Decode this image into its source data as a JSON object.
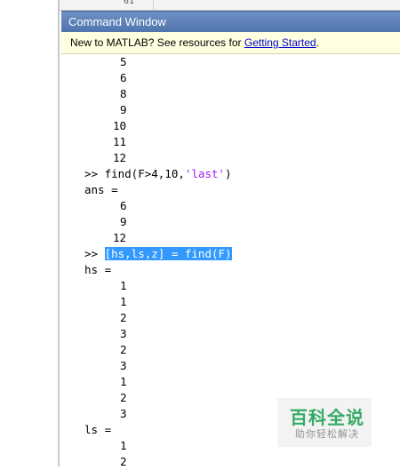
{
  "editor": {
    "line_number": "61"
  },
  "window": {
    "title": "Command Window"
  },
  "banner": {
    "prefix": "New to MATLAB? See resources for ",
    "link": "Getting Started",
    "suffix": "."
  },
  "console": {
    "top_numbers": [
      "5",
      "6",
      "8",
      "9",
      "10",
      "11",
      "12"
    ],
    "cmd1": {
      "prompt": ">> ",
      "code_a": "find(F>4,10,",
      "code_str": "'last'",
      "code_b": ")"
    },
    "ans_label": "ans =",
    "ans_numbers": [
      "6",
      "9",
      "12"
    ],
    "cmd2": {
      "prompt": ">> ",
      "code": "[hs,ls,z] = find(F)"
    },
    "hs_label": "hs =",
    "hs_numbers": [
      "1",
      "1",
      "2",
      "3",
      "2",
      "3",
      "1",
      "2",
      "3"
    ],
    "ls_label": "ls =",
    "ls_numbers": [
      "1",
      "2"
    ]
  },
  "watermark": {
    "title": "百科全说",
    "subtitle": "助你轻松解决"
  }
}
